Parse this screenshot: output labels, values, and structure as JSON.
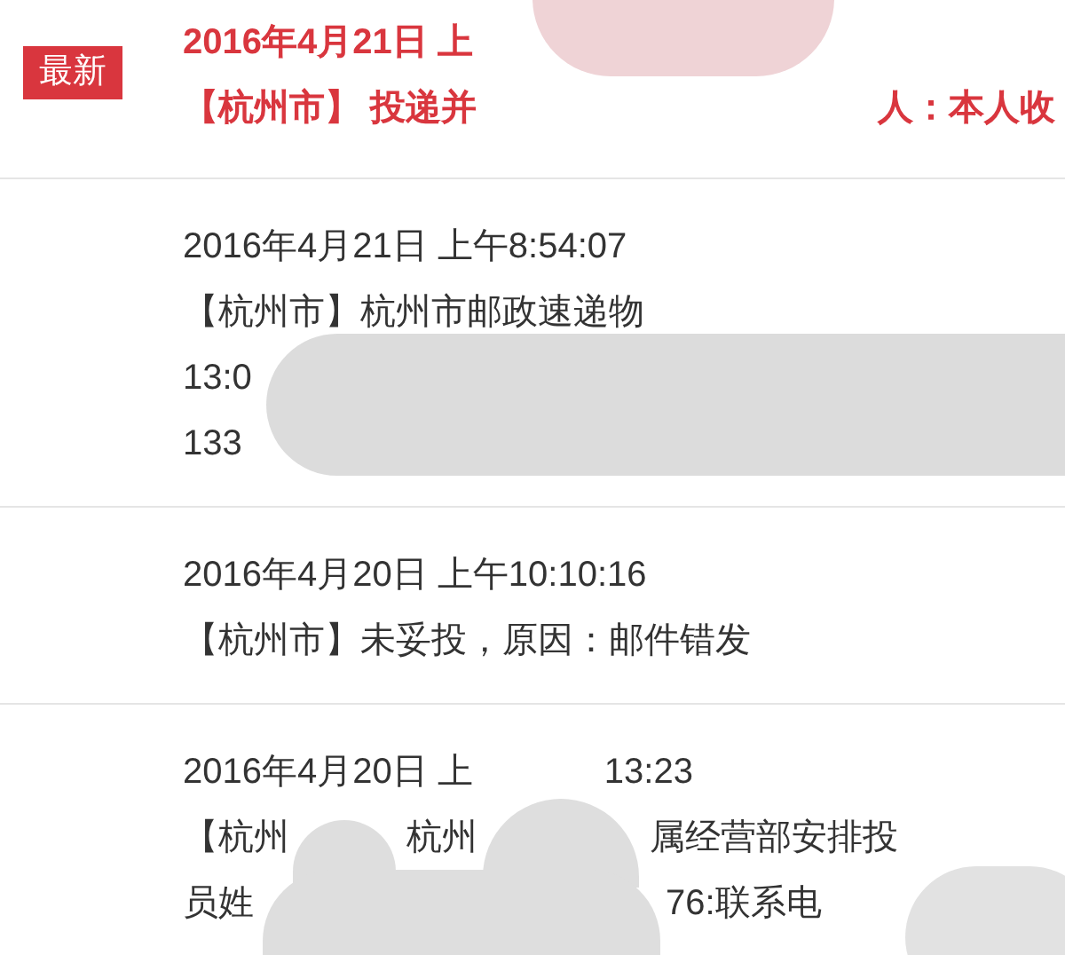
{
  "entries": [
    {
      "latest": true,
      "badge": "最新",
      "date": [
        "2016年4月21日 上"
      ],
      "lines": [
        [
          "【杭州市】 投递并",
          "人：本人收"
        ]
      ]
    },
    {
      "latest": false,
      "date": [
        "2016年4月21日 上午8:54:07"
      ],
      "lines": [
        [
          "【杭州市】杭州市邮政速递物"
        ],
        [
          "13:0"
        ],
        [
          "133"
        ]
      ]
    },
    {
      "latest": false,
      "date": [
        "2016年4月20日 上午10:10:16"
      ],
      "lines": [
        [
          "【杭州市】未妥投，原因：邮件错发"
        ]
      ]
    },
    {
      "latest": false,
      "date": [
        "2016年4月20日 上",
        "13:23"
      ],
      "lines": [
        [
          "【杭州",
          "杭州",
          "属经营部安排投"
        ],
        [
          "员姓",
          "76:联系电"
        ]
      ]
    }
  ]
}
